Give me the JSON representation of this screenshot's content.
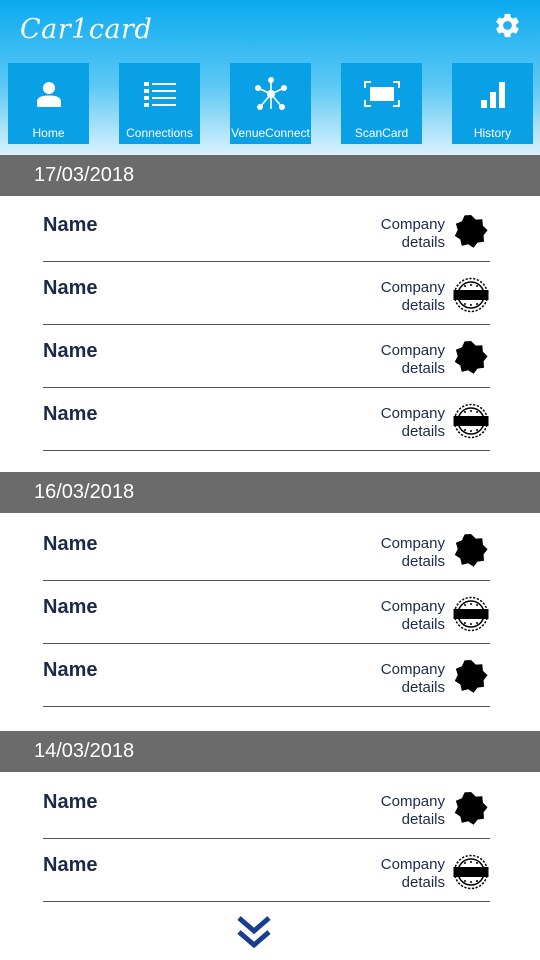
{
  "app": {
    "logo": "Car1card"
  },
  "colors": {
    "accent": "#0aa0e6",
    "date_bar": "#6b6b6b",
    "text_dark": "#1c2a4a",
    "chevron": "#1a3d8f"
  },
  "nav": [
    {
      "label": "Home",
      "icon": "person-icon"
    },
    {
      "label": "Connections",
      "icon": "list-icon"
    },
    {
      "label": "VenueConnect",
      "icon": "network-icon"
    },
    {
      "label": "ScanCard",
      "icon": "scan-icon"
    },
    {
      "label": "History",
      "icon": "bar-chart-icon"
    }
  ],
  "groups": [
    {
      "date": "17/03/2018",
      "entries": [
        {
          "name": "Name",
          "company_line1": "Company",
          "company_line2": "details",
          "badge": "seal-icon"
        },
        {
          "name": "Name",
          "company_line1": "Company",
          "company_line2": "details",
          "badge": "stamp-seal-icon"
        },
        {
          "name": "Name",
          "company_line1": "Company",
          "company_line2": "details",
          "badge": "seal-icon"
        },
        {
          "name": "Name",
          "company_line1": "Company",
          "company_line2": "details",
          "badge": "stamp-seal-icon"
        }
      ]
    },
    {
      "date": "16/03/2018",
      "entries": [
        {
          "name": "Name",
          "company_line1": "Company",
          "company_line2": "details",
          "badge": "seal-icon"
        },
        {
          "name": "Name",
          "company_line1": "Company",
          "company_line2": "details",
          "badge": "stamp-seal-icon"
        },
        {
          "name": "Name",
          "company_line1": "Company",
          "company_line2": "details",
          "badge": "seal-icon"
        }
      ]
    },
    {
      "date": "14/03/2018",
      "entries": [
        {
          "name": "Name",
          "company_line1": "Company",
          "company_line2": "details",
          "badge": "seal-icon"
        },
        {
          "name": "Name",
          "company_line1": "Company",
          "company_line2": "details",
          "badge": "stamp-seal-icon"
        }
      ]
    }
  ]
}
